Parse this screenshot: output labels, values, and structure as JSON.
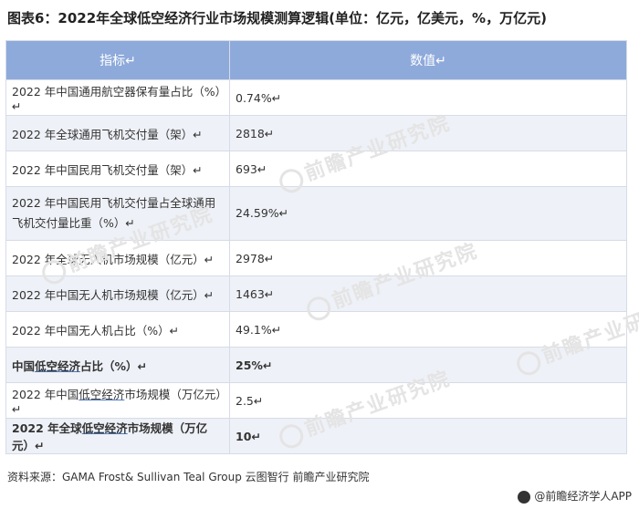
{
  "title": "图表6：2022年全球低空经济行业市场规模测算逻辑(单位：亿元，亿美元，%，万亿元)",
  "table": {
    "headers": [
      "指标↵",
      "数值↵"
    ],
    "rows": [
      {
        "label": "2022 年中国通用航空器保有量占比（%）↵",
        "value": "0.74%↵"
      },
      {
        "label": "2022 年全球通用飞机交付量（架）↵",
        "value": "2818↵"
      },
      {
        "label": "2022 年中国民用飞机交付量（架）↵",
        "value": "693↵"
      },
      {
        "label": "2022 年中国民用飞机交付量占全球通用飞机交付量比重（%）↵",
        "value": "24.59%↵"
      },
      {
        "label": "2022 年全球无人机市场规模（亿元）↵",
        "value": "2978↵"
      },
      {
        "label": "2022 年中国无人机市场规模（亿元）↵",
        "value": "1463↵"
      },
      {
        "label": "2022 年中国无人机占比（%）↵",
        "value": "49.1%↵"
      },
      {
        "label_pre": "中国",
        "label_hl": "低空经济",
        "label_post": "占比（%）↵",
        "value": "25%↵"
      },
      {
        "label_pre": "2022 年中国",
        "label_hl": "低空经济",
        "label_post": "市场规模（万亿元）↵",
        "value": "2.5↵"
      },
      {
        "label_pre": "2022 年全球",
        "label_hl": "低空经济",
        "label_post": "市场规模（万亿元）↵",
        "value": "10↵"
      }
    ]
  },
  "watermark": "前瞻产业研究院",
  "source": "资料来源：GAMA  Frost& Sullivan Teal Group 云图智行 前瞻产业研究院",
  "footer": "@前瞻经济学人APP"
}
